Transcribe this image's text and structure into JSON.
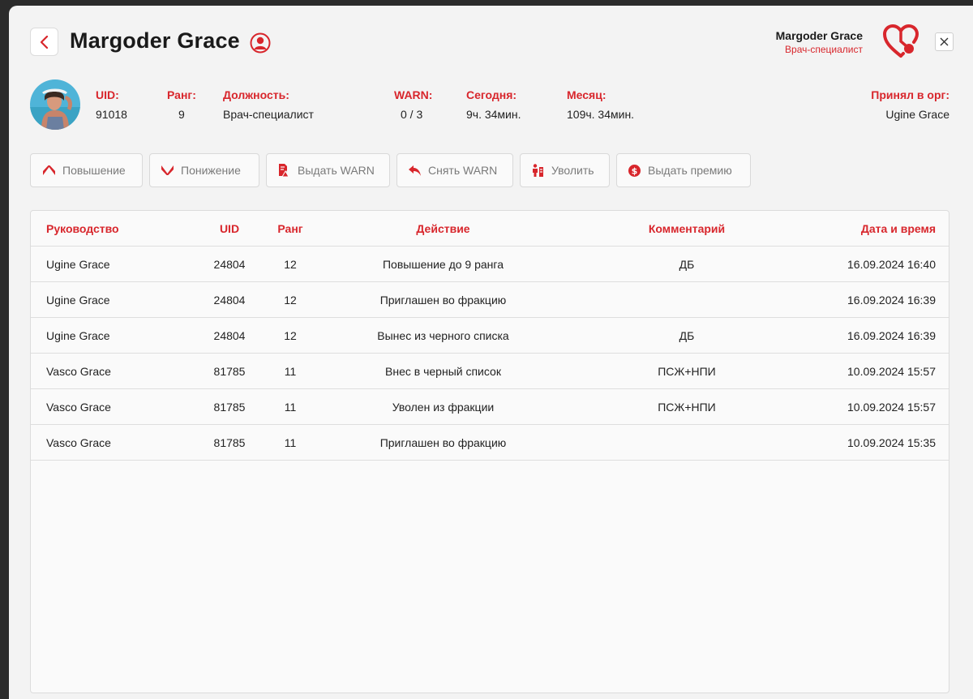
{
  "header": {
    "title": "Margoder Grace",
    "org_user_name": "Margoder Grace",
    "org_user_role": "Врач-специалист"
  },
  "icons": {
    "back": "chevron-left-icon",
    "user_badge": "user-circle-icon",
    "org_logo": "heart-org-logo",
    "close": "close-icon"
  },
  "colors": {
    "accent": "#d8262c",
    "muted_text": "#7a7a7a",
    "background": "#f3f3f3"
  },
  "profile": {
    "fields": [
      {
        "label": "UID:",
        "value": "91018"
      },
      {
        "label": "Ранг:",
        "value": "9"
      },
      {
        "label": "Должность:",
        "value": "Врач-специалист"
      },
      {
        "label": "WARN:",
        "value": "0 / 3"
      },
      {
        "label": "Сегодня:",
        "value": "9ч. 34мин."
      },
      {
        "label": "Месяц:",
        "value": "109ч. 34мин."
      },
      {
        "label": "Принял в орг:",
        "value": "Ugine Grace"
      }
    ]
  },
  "actions": [
    {
      "label": "Повышение",
      "icon": "chevron-up-icon"
    },
    {
      "label": "Понижение",
      "icon": "chevron-down-icon"
    },
    {
      "label": "Выдать WARN",
      "icon": "document-warning-icon"
    },
    {
      "label": "Снять WARN",
      "icon": "reply-arrow-icon"
    },
    {
      "label": "Уволить",
      "icon": "fire-person-icon"
    },
    {
      "label": "Выдать премию",
      "icon": "dollar-coin-icon"
    }
  ],
  "log_table": {
    "columns": [
      "Руководство",
      "UID",
      "Ранг",
      "Действие",
      "Комментарий",
      "Дата и время"
    ],
    "rows": [
      {
        "leader": "Ugine Grace",
        "uid": "24804",
        "rank": "12",
        "action": "Повышение до 9 ранга",
        "comment": "ДБ",
        "datetime": "16.09.2024 16:40"
      },
      {
        "leader": "Ugine Grace",
        "uid": "24804",
        "rank": "12",
        "action": "Приглашен во фракцию",
        "comment": "",
        "datetime": "16.09.2024 16:39"
      },
      {
        "leader": "Ugine Grace",
        "uid": "24804",
        "rank": "12",
        "action": "Вынес из черного списка",
        "comment": "ДБ",
        "datetime": "16.09.2024 16:39"
      },
      {
        "leader": "Vasco Grace",
        "uid": "81785",
        "rank": "11",
        "action": "Внес в черный список",
        "comment": "ПСЖ+НПИ",
        "datetime": "10.09.2024 15:57"
      },
      {
        "leader": "Vasco Grace",
        "uid": "81785",
        "rank": "11",
        "action": "Уволен из фракции",
        "comment": "ПСЖ+НПИ",
        "datetime": "10.09.2024 15:57"
      },
      {
        "leader": "Vasco Grace",
        "uid": "81785",
        "rank": "11",
        "action": "Приглашен во фракцию",
        "comment": "",
        "datetime": "10.09.2024 15:35"
      }
    ]
  }
}
